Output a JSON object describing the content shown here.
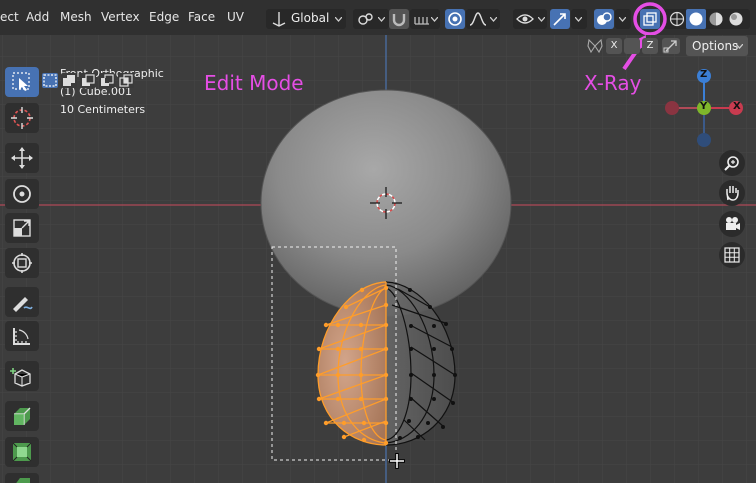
{
  "menu": {
    "items": [
      "ect",
      "Add",
      "Mesh",
      "Vertex",
      "Edge",
      "Face",
      "UV"
    ]
  },
  "header": {
    "transform_orientation": "Global",
    "options_label": "Options",
    "axis_x": "X",
    "axis_z": "Z"
  },
  "overlay_text": {
    "view_name": "Front Orthographic",
    "object_name": "(1) Cube.001",
    "scale": "10 Centimeters"
  },
  "annotations": {
    "edit_mode": "Edit Mode",
    "xray": "X-Ray"
  },
  "gizmo": {
    "z": "Z",
    "y": "Y",
    "x": "X"
  },
  "colors": {
    "accent_active": "#4772b3",
    "annotation": "#e54ee5",
    "selection": "#ff9d2a",
    "axis_x": "#c83b4f",
    "axis_y": "#7fb72b",
    "axis_z": "#3b7fd6"
  },
  "icons": {
    "tools": [
      "select-box-icon",
      "cursor-icon",
      "move-icon",
      "rotate-icon",
      "scale-icon",
      "transform-icon",
      "annotate-icon",
      "measure-icon",
      "add-cube-icon",
      "extrude-icon",
      "inset-icon"
    ],
    "navigation": [
      "zoom-icon",
      "pan-hand-icon",
      "camera-icon",
      "grid-icon"
    ]
  }
}
